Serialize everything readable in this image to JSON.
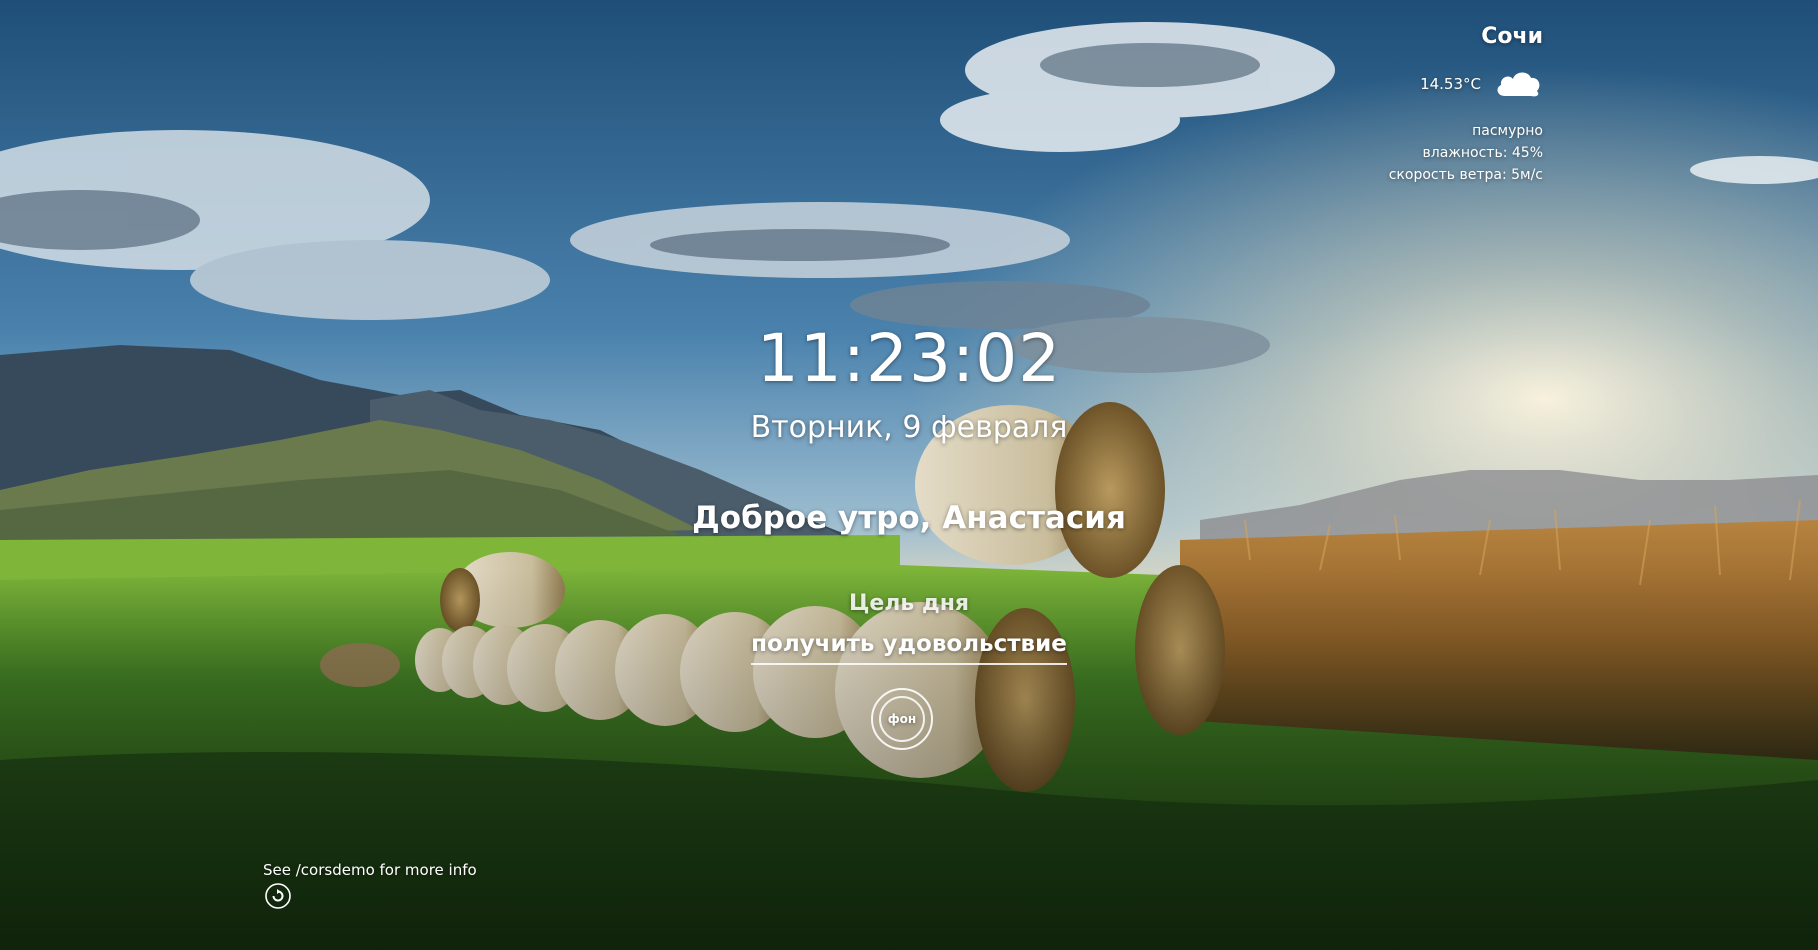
{
  "weather": {
    "city": "Сочи",
    "temperature": "14.53°C",
    "icon": "cloud-icon",
    "description": "пасмурно",
    "humidity": "влажность: 45%",
    "wind": "скорость ветра: 5м/с"
  },
  "clock": {
    "time": "11:23:02",
    "date": "Вторник, 9 февраля"
  },
  "greeting": {
    "text": "Доброе утро,",
    "name": "Анастасия"
  },
  "goal": {
    "title": "Цель дня",
    "text": "получить удовольствие"
  },
  "background_button": {
    "label": "фон",
    "icon": "refresh-icon"
  },
  "quote": {
    "text": "See /corsdemo for more info",
    "refresh_icon": "refresh-icon"
  }
}
